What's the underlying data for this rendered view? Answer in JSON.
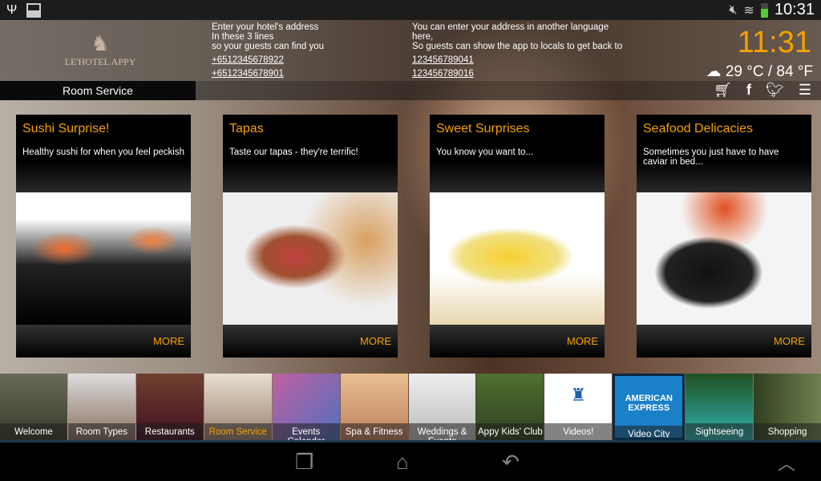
{
  "status": {
    "time": "10:31",
    "left_icons": [
      "usb-icon",
      "gallery-icon"
    ],
    "right_icons": [
      "mute-icon",
      "wifi-icon",
      "battery-icon"
    ]
  },
  "header": {
    "logo_text": "LE'HOTEL APPY",
    "address1": {
      "lines": [
        "Enter your hotel's address",
        "In these 3 lines",
        "so your guests can find you"
      ],
      "phones": [
        "+6512345678922",
        "+6512345678901"
      ]
    },
    "address2": {
      "lines": [
        "You can enter your address in another language",
        "here,",
        "So guests can show the app to locals to get back to"
      ],
      "phones": [
        "123456789041",
        "123456789016"
      ]
    },
    "clock": "11:31",
    "weather": "29 °C / 84 °F"
  },
  "breadcrumb": "Room Service",
  "header_icons": [
    "cart-icon",
    "facebook-icon",
    "twitter-icon",
    "menu-icon"
  ],
  "cards": [
    {
      "title": "Sushi Surprise!",
      "desc": "Healthy sushi for when you feel peckish",
      "more": "MORE"
    },
    {
      "title": "Tapas",
      "desc": "Taste our tapas - they're terrific!",
      "more": "MORE"
    },
    {
      "title": "Sweet Surprises",
      "desc": "You know you want to...",
      "more": "MORE"
    },
    {
      "title": "Seafood Delicacies",
      "desc": "Sometimes you just have to have caviar in bed...",
      "more": "MORE"
    }
  ],
  "tiles": [
    "Welcome",
    "Room Types",
    "Restaurants",
    "Room Service",
    "Events Calendar",
    "Spa & Fitness",
    "Weddings & Events",
    "Appy Kids' Club",
    "Videos!",
    "Video City Guide",
    "Sightseeing",
    "Shopping"
  ],
  "active_tile": "Room Service",
  "colors": {
    "accent": "#f5a000"
  }
}
